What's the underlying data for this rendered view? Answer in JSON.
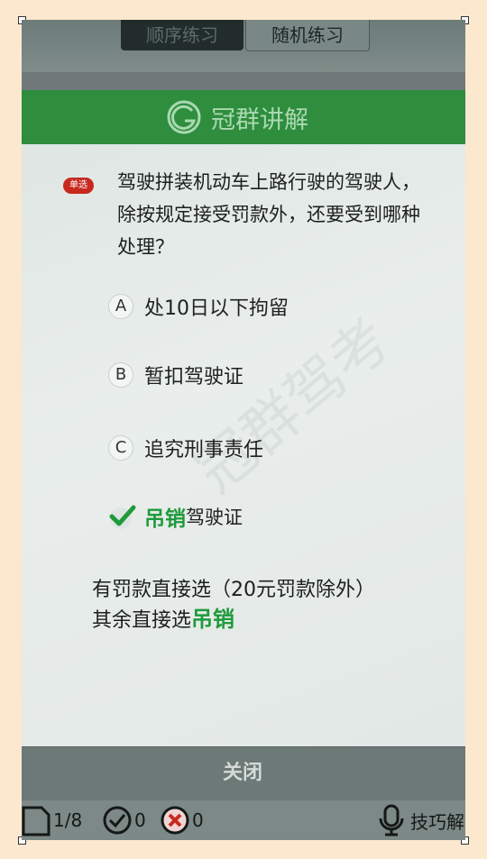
{
  "tabs": [
    {
      "label": "顺序练习",
      "active": true
    },
    {
      "label": "随机练习",
      "active": false
    }
  ],
  "header": {
    "title": "冠群讲解",
    "logo_icon": "g-circle-logo-icon"
  },
  "question": {
    "type_badge": "单选",
    "text": "驾驶拼装机动车上路行驶的驾驶人，除按规定接受罚款外，还要受到哪种处理？"
  },
  "options": [
    {
      "letter": "A",
      "text": "处10日以下拘留"
    },
    {
      "letter": "B",
      "text": "暂扣驾驶证"
    },
    {
      "letter": "C",
      "text": "追究刑事责任"
    }
  ],
  "answer": {
    "highlight": "吊销",
    "rest": "驾驶证",
    "icon": "checkmark-icon"
  },
  "explanation": {
    "line1": "有罚款直接选（20元罚款除外）",
    "line2_prefix": "其余直接选",
    "line2_highlight": "吊销"
  },
  "watermark": "冠群驾考",
  "close_label": "关闭",
  "status": {
    "progress": "1/8",
    "correct_count": "0",
    "wrong_count": "0",
    "tips_label": "技巧解"
  },
  "colors": {
    "header_green": "#2f8d3e",
    "answer_green": "#1f9a3b",
    "badge_red": "#c8291f",
    "page_bg": "#fbe8cf"
  }
}
